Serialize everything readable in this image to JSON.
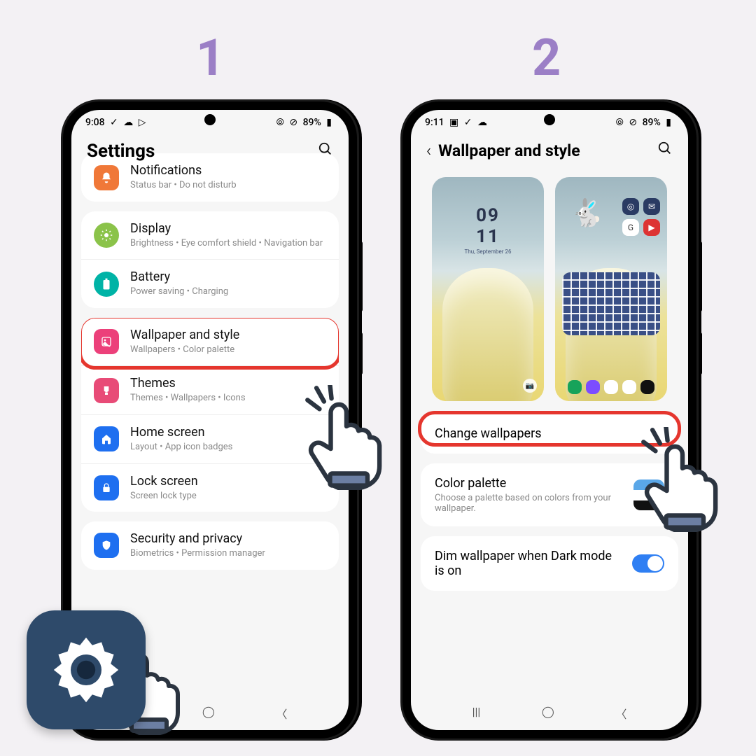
{
  "steps": {
    "one": "1",
    "two": "2"
  },
  "phone1": {
    "status": {
      "time": "9:08",
      "battery": "89%"
    },
    "header": {
      "title": "Settings"
    },
    "rows": {
      "notifications": {
        "title": "Notifications",
        "sub": "Status bar  •  Do not disturb"
      },
      "display": {
        "title": "Display",
        "sub": "Brightness  •  Eye comfort shield  •  Navigation bar"
      },
      "battery": {
        "title": "Battery",
        "sub": "Power saving  •  Charging"
      },
      "wallpaper": {
        "title": "Wallpaper and style",
        "sub": "Wallpapers  •  Color palette"
      },
      "themes": {
        "title": "Themes",
        "sub": "Themes  •  Wallpapers  •  Icons"
      },
      "home": {
        "title": "Home screen",
        "sub": "Layout  •  App icon badges"
      },
      "lock": {
        "title": "Lock screen",
        "sub": "Screen lock type"
      },
      "security": {
        "title": "Security and privacy",
        "sub": "Biometrics  •  Permission manager"
      }
    }
  },
  "phone2": {
    "status": {
      "time": "9:11",
      "battery": "89%"
    },
    "header": {
      "title": "Wallpaper and style"
    },
    "clock": {
      "hm": "09\n11",
      "date": "Thu, September 26"
    },
    "options": {
      "change": {
        "title": "Change wallpapers"
      },
      "palette": {
        "title": "Color palette",
        "sub": "Choose a palette based on colors from your wallpaper."
      },
      "dim": {
        "title": "Dim wallpaper when Dark mode is on"
      }
    }
  },
  "colors": {
    "notif": "#f07838",
    "display": "#8bc34a",
    "battery": "#00b3a6",
    "wallpaper": "#ec407a",
    "themes": "#e84b77",
    "home": "#1e6ff0",
    "lock": "#1e6ff0",
    "security": "#1e6ff0"
  }
}
